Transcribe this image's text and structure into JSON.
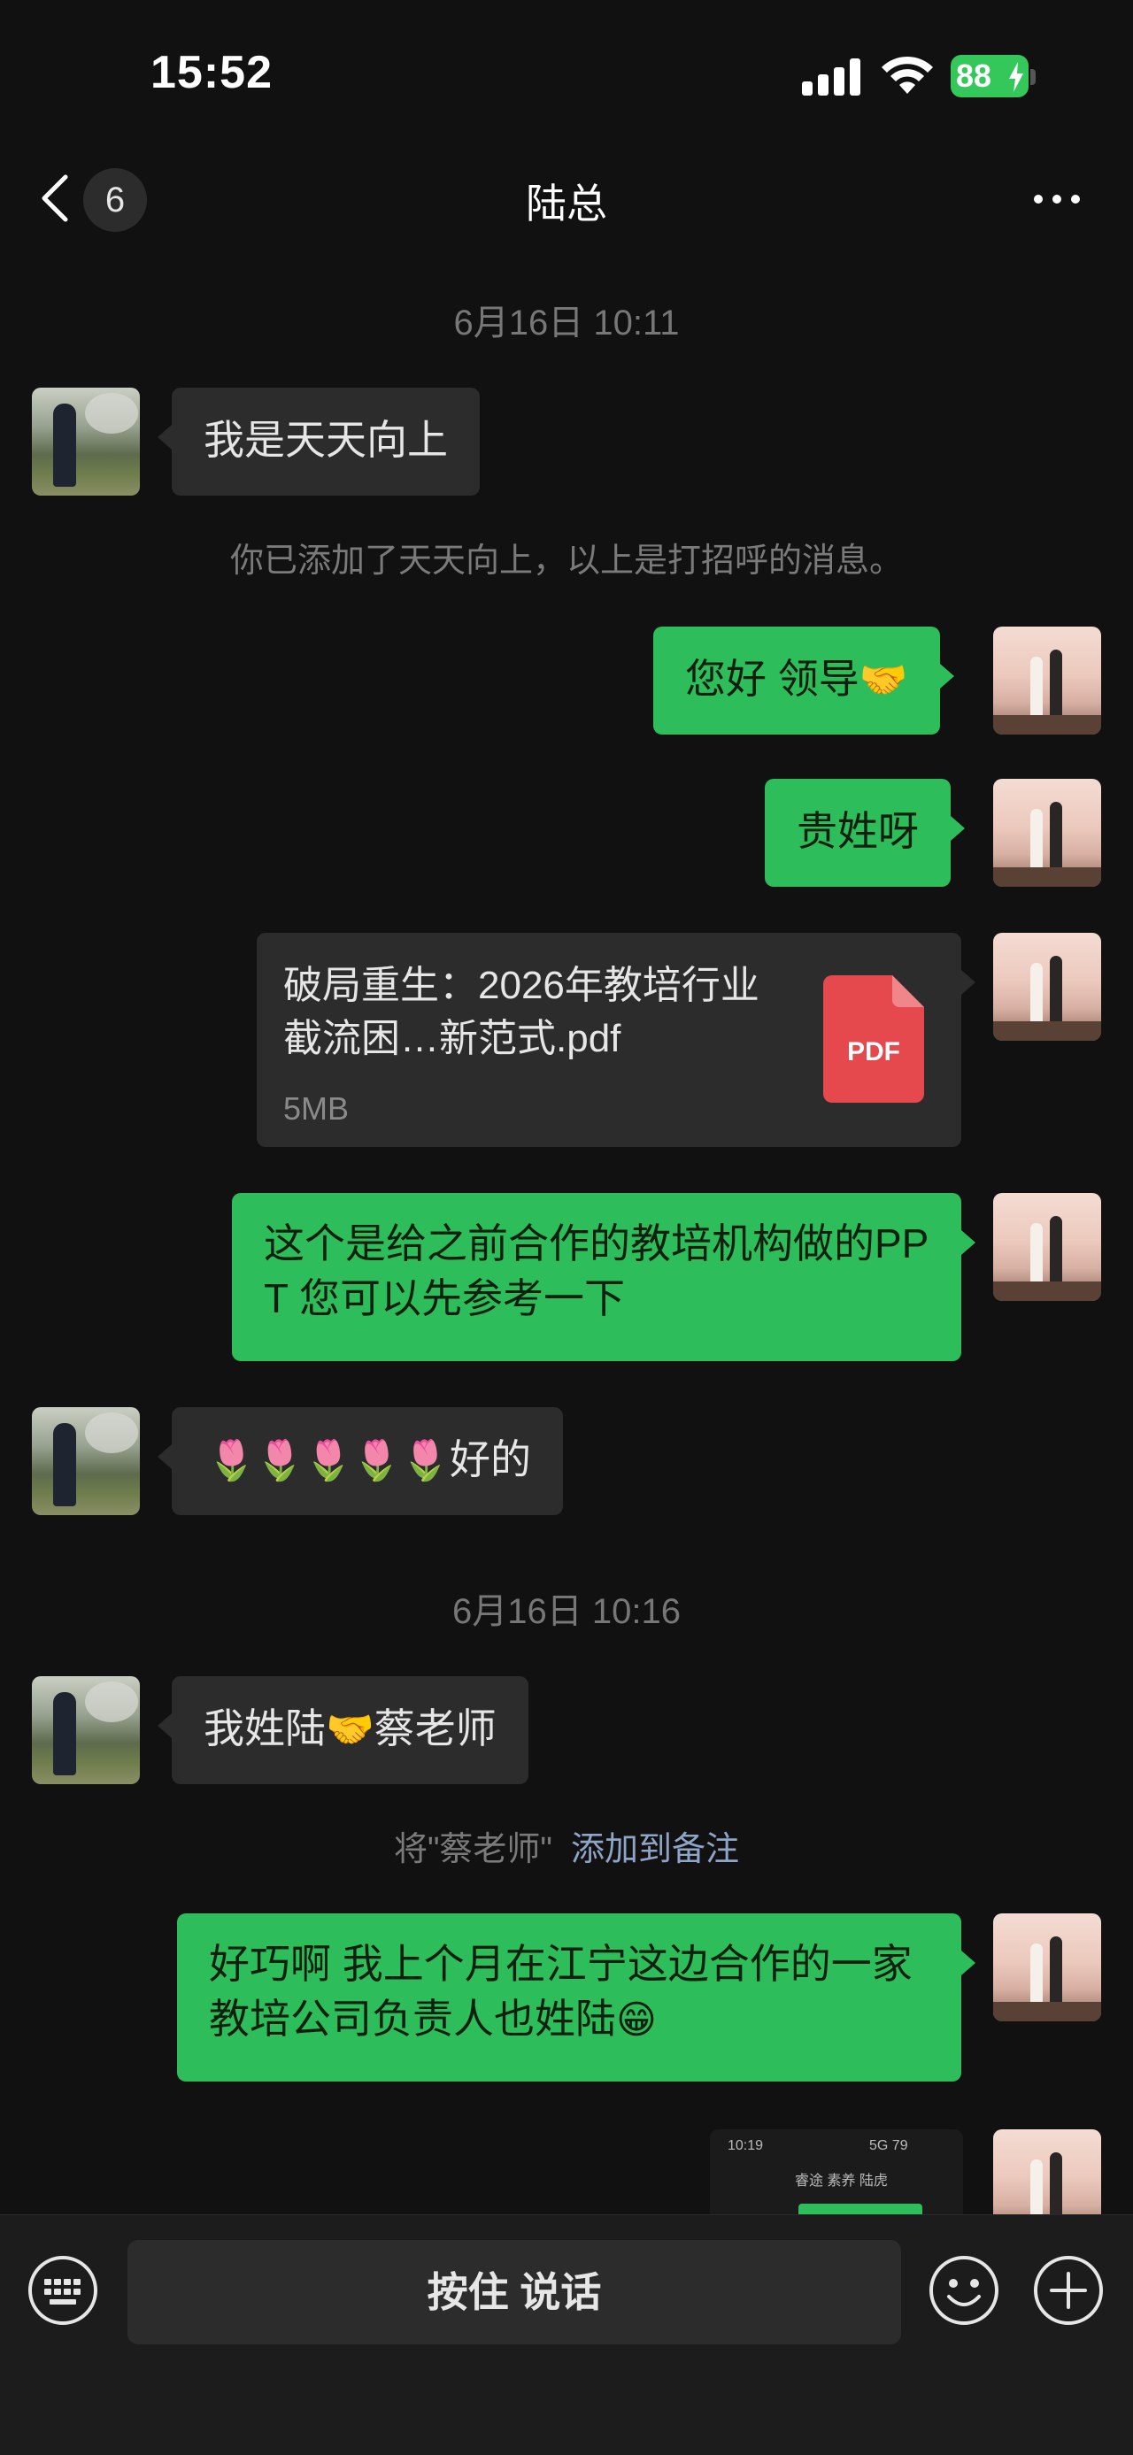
{
  "status_bar": {
    "time": "15:52",
    "battery": "88"
  },
  "nav": {
    "back_count": "6",
    "title": "陆总"
  },
  "chat": {
    "timestamp_1": "6月16日 10:11",
    "msg_1": "我是天天向上",
    "sys_1": "你已添加了天天向上，以上是打招呼的消息。",
    "msg_2_text": "您好 领导",
    "msg_2_emoji": "🤝",
    "msg_3": "贵姓呀",
    "file": {
      "name": "破局重生：2026年教培行业截流困…新范式.pdf",
      "size": "5MB",
      "type_label": "PDF"
    },
    "msg_5": "这个是给之前合作的教培机构做的PP T 您可以先参考一下",
    "msg_6_emoji": "🌷🌷🌷🌷🌷",
    "msg_6_text": "好的",
    "timestamp_2": "6月16日 10:16",
    "msg_7_a": "我姓陆",
    "msg_7_emoji": "🤝",
    "msg_7_b": "蔡老师",
    "sys_2_prefix": "将\"蔡老师\"",
    "sys_2_link": "添加到备注",
    "msg_8_text": "好巧啊 我上个月在江宁这边合作的一家教培公司负责人也姓陆",
    "msg_8_emoji": "😁",
    "image_preview": {
      "time": "10:19",
      "signal": "5G",
      "battery": "79",
      "title": "睿途 素养 陆虎"
    }
  },
  "input_bar": {
    "voice_label": "按住 说话"
  },
  "colors": {
    "self_bubble": "#2ebd5b",
    "other_bubble": "#2c2c2c",
    "background": "#111111",
    "pdf_red": "#e5484d",
    "link": "#8fa5c8"
  }
}
